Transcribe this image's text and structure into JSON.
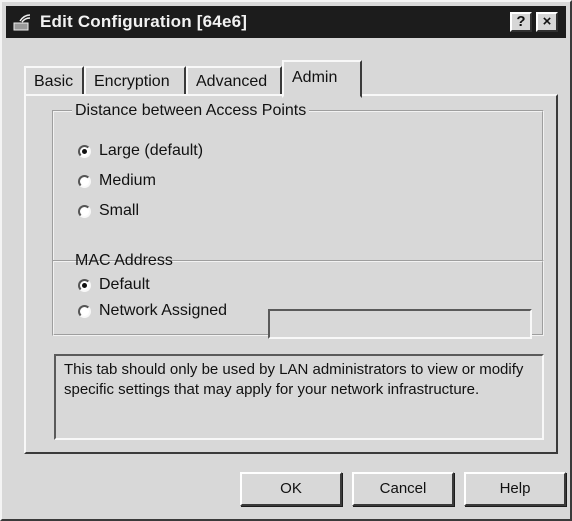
{
  "window": {
    "title": "Edit Configuration [64e6]",
    "help_glyph": "?",
    "close_glyph": "×"
  },
  "tabs": [
    {
      "label": "Basic",
      "active": false
    },
    {
      "label": "Encryption",
      "active": false
    },
    {
      "label": "Advanced",
      "active": false
    },
    {
      "label": "Admin",
      "active": true
    }
  ],
  "distance_group": {
    "legend": "Distance between Access Points",
    "options": [
      {
        "label": "Large (default)",
        "checked": true
      },
      {
        "label": "Medium",
        "checked": false
      },
      {
        "label": "Small",
        "checked": false
      }
    ]
  },
  "mac_group": {
    "legend": "MAC Address",
    "options": [
      {
        "label": "Default",
        "checked": true
      },
      {
        "label": "Network Assigned",
        "checked": false
      }
    ],
    "network_assigned_value": ""
  },
  "info_text": "This tab should only be used by LAN administrators to view or modify specific settings that may apply for your network infrastructure.",
  "buttons": {
    "ok": "OK",
    "cancel": "Cancel",
    "help": "Help"
  }
}
